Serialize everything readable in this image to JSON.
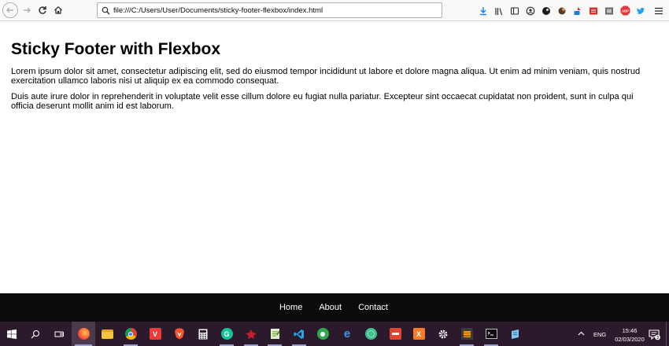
{
  "browser": {
    "url": "file:///C:/Users/User/Documents/sticky-footer-flexbox/index.html",
    "toolbar_icons": [
      "download-icon",
      "library-icon",
      "sidebar-icon",
      "account-icon",
      "extension-dark-icon",
      "extension-brown-icon",
      "extension-blue-icon",
      "extension-red-icon",
      "extension-gray-icon",
      "adblock-icon",
      "twitter-icon"
    ]
  },
  "page": {
    "title": "Sticky Footer with Flexbox",
    "paragraphs": [
      "Lorem ipsum dolor sit amet, consectetur adipiscing elit, sed do eiusmod tempor incididunt ut labore et dolore magna aliqua. Ut enim ad minim veniam, quis nostrud exercitation ullamco laboris nisi ut aliquip ex ea commodo consequat.",
      "Duis aute irure dolor in reprehenderit in voluptate velit esse cillum dolore eu fugiat nulla pariatur. Excepteur sint occaecat cupidatat non proident, sunt in culpa qui officia deserunt mollit anim id est laborum."
    ]
  },
  "footer": {
    "links": [
      "Home",
      "About",
      "Contact"
    ]
  },
  "taskbar": {
    "apps": [
      "windows-start-icon",
      "search-icon",
      "task-view-icon",
      "firefox-icon",
      "file-explorer-icon",
      "chrome-icon",
      "vivaldi-icon",
      "brave-icon",
      "calculator-icon",
      "grammarly-icon",
      "app-red-icon",
      "notepad-icon",
      "vscode-icon",
      "app-green-icon",
      "edge-icon",
      "app-teal-icon",
      "app-orange-icon",
      "xampp-icon",
      "settings-icon",
      "sublime-icon",
      "terminal-icon",
      "app-blue-icon"
    ],
    "tray": {
      "language": "ENG",
      "time": "15:46",
      "date": "02/03/2020",
      "notification_count": "3"
    }
  },
  "colors": {
    "footer_bg": "#0b0b0b",
    "taskbar_bg": "#2b1a2c",
    "browser_bar_bg": "#f9f9fa"
  }
}
